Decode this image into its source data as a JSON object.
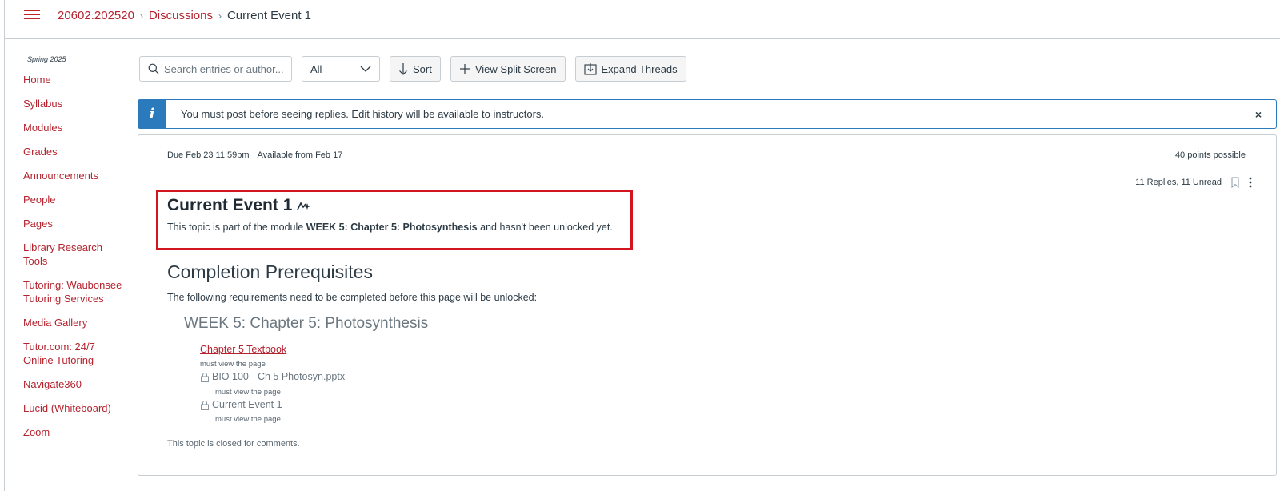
{
  "breadcrumb": {
    "course": "20602.202520",
    "section": "Discussions",
    "current": "Current Event 1"
  },
  "sidebar": {
    "term": "Spring 2025",
    "items": [
      {
        "label": "Home"
      },
      {
        "label": "Syllabus"
      },
      {
        "label": "Modules"
      },
      {
        "label": "Grades"
      },
      {
        "label": "Announcements"
      },
      {
        "label": "People"
      },
      {
        "label": "Pages"
      },
      {
        "label": "Library Research Tools"
      },
      {
        "label": "Tutoring: Waubonsee Tutoring Services"
      },
      {
        "label": "Media Gallery"
      },
      {
        "label": "Tutor.com: 24/7 Online Tutoring"
      },
      {
        "label": "Navigate360"
      },
      {
        "label": "Lucid (Whiteboard)"
      },
      {
        "label": "Zoom"
      }
    ]
  },
  "toolbar": {
    "search_placeholder": "Search entries or author...",
    "filter_value": "All",
    "sort_label": "Sort",
    "split_label": "View Split Screen",
    "expand_label": "Expand Threads"
  },
  "alert": {
    "icon": "i",
    "text": "You must post before seeing replies. Edit history will be available to instructors.",
    "close": "×"
  },
  "topic": {
    "due": "Due Feb 23 11:59pm",
    "available": "Available from Feb 17",
    "points": "40 points possible",
    "replies": "11 Replies, 11 Unread",
    "title": "Current Event 1",
    "desc_prefix": "This topic is part of the module ",
    "desc_module": "WEEK 5: Chapter 5: Photosynthesis",
    "desc_suffix": " and hasn't been unlocked yet."
  },
  "prerequisites": {
    "title": "Completion Prerequisites",
    "desc": "The following requirements need to be completed before this page will be unlocked:",
    "module": "WEEK 5: Chapter 5: Photosynthesis",
    "items": [
      {
        "label": "Chapter 5 Textbook",
        "note": "must view the page",
        "locked": false
      },
      {
        "label": "BIO 100 - Ch 5 Photosyn.pptx",
        "note": "must view the page",
        "locked": true
      },
      {
        "label": "Current Event 1",
        "note": "must view the page",
        "locked": true
      }
    ]
  },
  "closed_text": "This topic is closed for comments.",
  "colors": {
    "brand_red": "#b5232e",
    "info_blue": "#2b7abc",
    "highlight_red": "#d3151f"
  }
}
